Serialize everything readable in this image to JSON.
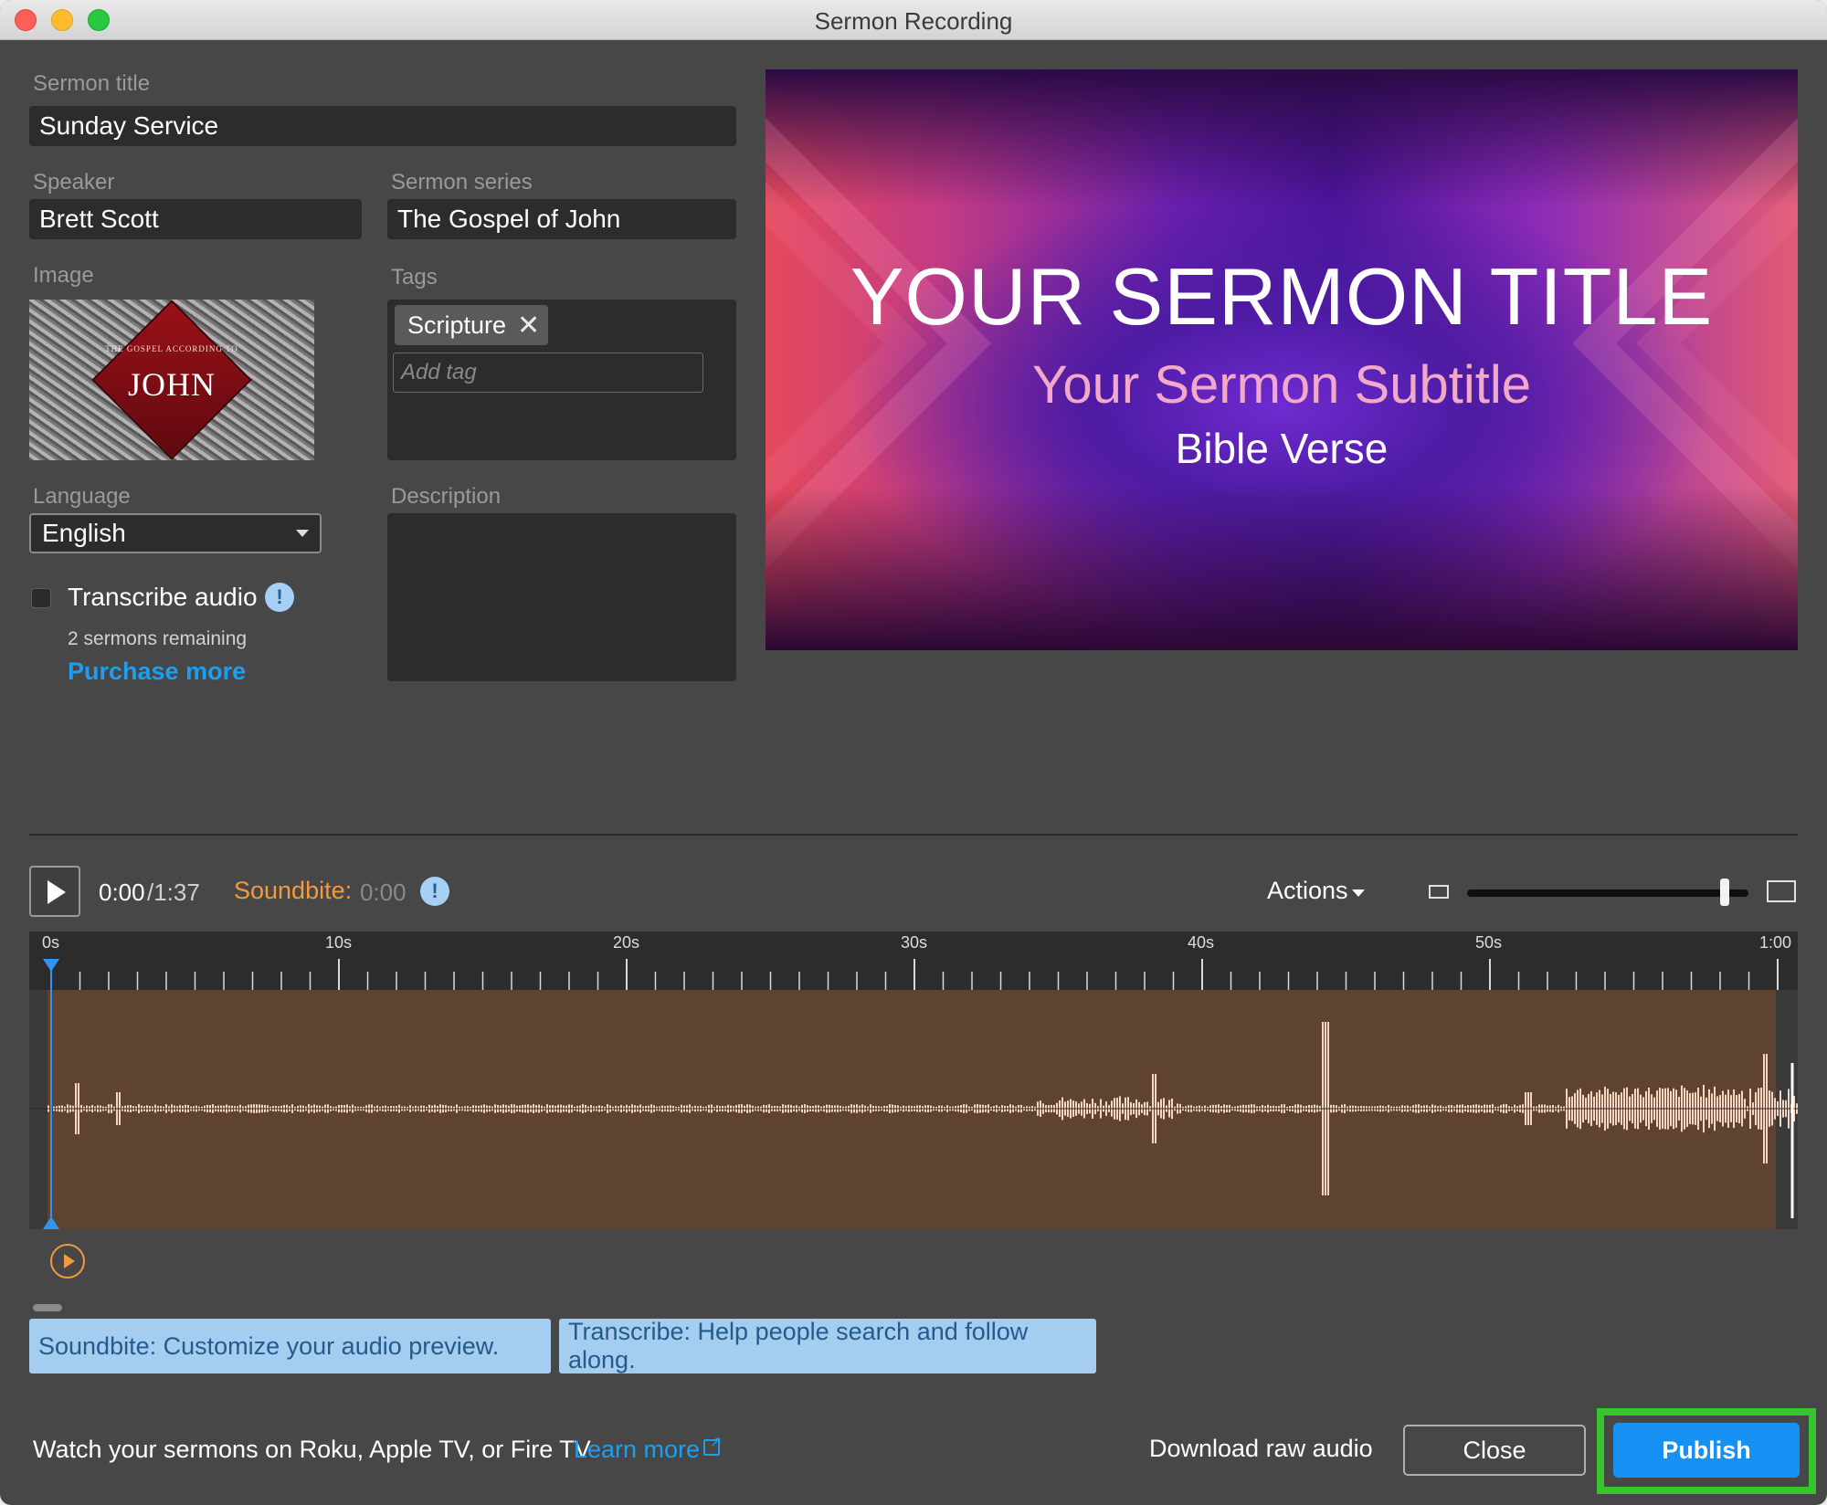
{
  "window": {
    "title": "Sermon Recording"
  },
  "form": {
    "sermon_title_label": "Sermon title",
    "sermon_title_value": "Sunday Service",
    "speaker_label": "Speaker",
    "speaker_value": "Brett Scott",
    "series_label": "Sermon series",
    "series_value": "The Gospel of John",
    "image_label": "Image",
    "image_text_small": "THE GOSPEL ACCORDING TO",
    "image_text_main": "JOHN",
    "tags_label": "Tags",
    "tags": [
      "Scripture"
    ],
    "add_tag_placeholder": "Add tag",
    "language_label": "Language",
    "language_value": "English",
    "transcribe_label": "Transcribe audio",
    "transcribe_checked": false,
    "info_glyph": "!",
    "remaining_text": "2 sermons remaining",
    "purchase_link": "Purchase more",
    "description_label": "Description",
    "description_value": ""
  },
  "preview": {
    "title": "YOUR SERMON TITLE",
    "subtitle": "Your Sermon Subtitle",
    "verse": "Bible Verse"
  },
  "player": {
    "current_time": "0:00",
    "total_time": "/1:37",
    "soundbite_label": "Soundbite:",
    "soundbite_time": "0:00",
    "actions_label": "Actions",
    "zoom_level": 0.93
  },
  "timeline": {
    "tick_labels": [
      "0s",
      "10s",
      "20s",
      "30s",
      "40s",
      "50s",
      "1:00"
    ],
    "playhead_time": "0:00",
    "waveform_color": "#5e4330",
    "wave_fill": "#f6d6c2"
  },
  "hints": {
    "soundbite": "Soundbite: Customize your audio preview.",
    "transcribe": "Transcribe: Help people search and follow along."
  },
  "footer": {
    "watch_text": "Watch your sermons on Roku, Apple TV, or Fire TV",
    "learn_more": "Learn more",
    "download": "Download raw audio",
    "close": "Close",
    "publish": "Publish"
  },
  "colors": {
    "accent_blue": "#1c9ff0",
    "soundbite_orange": "#f39a3c",
    "publish_highlight": "#37c52e"
  }
}
